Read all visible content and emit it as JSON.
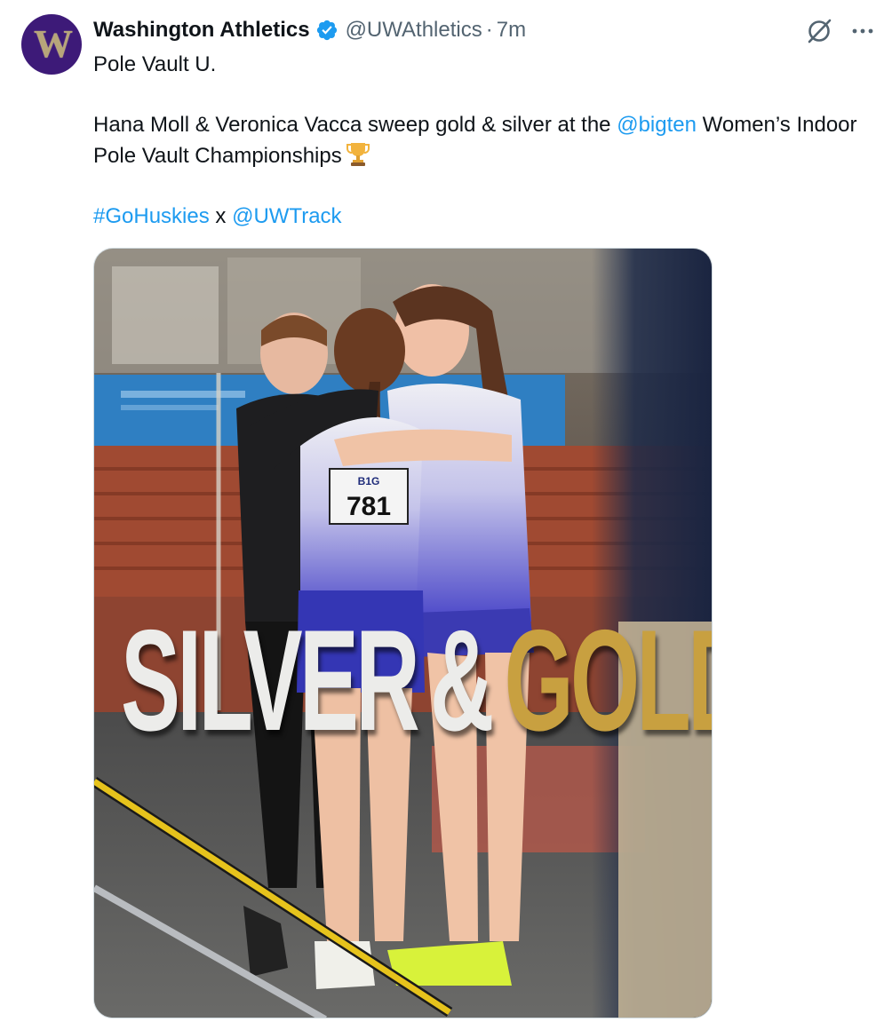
{
  "author": {
    "display_name": "Washington Athletics",
    "handle": "@UWAthletics",
    "separator": "·",
    "time": "7m",
    "avatar_letter": "W",
    "verified_color": "#1d9bf0",
    "avatar_color": "#3d1a78"
  },
  "tweet": {
    "line1": "Pole Vault U.",
    "line2_before": "Hana Moll & Veronica Vacca sweep gold & silver at the ",
    "mention_bigten": "@bigten",
    "line2_after": " Women’s Indoor Pole Vault Championships",
    "trophy_icon": "trophy-emoji",
    "hashtag": "#GoHuskies",
    "joiner": " x ",
    "mention_uwtrack": "@UWTrack",
    "link_color": "#1d9bf0"
  },
  "media": {
    "headline_silver": "SILVER",
    "headline_amp": "&",
    "headline_gold": "GOLD.",
    "bib_number": "781",
    "bib_logo": "B1G"
  },
  "icons": {
    "grok": "grok-icon",
    "more": "more-icon",
    "verified": "verified-badge-icon"
  }
}
